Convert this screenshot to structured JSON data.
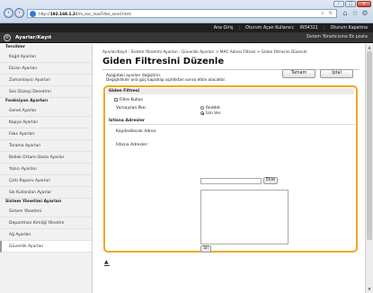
{
  "browser": {
    "url_prefix": "http://",
    "url_host": "192.168.1.2",
    "url_path": "4/m_sec_macFilter_send.html",
    "toolbar_icons": [
      "search-icon",
      "refresh-icon",
      "home-icon",
      "star-icon",
      "gear-icon"
    ],
    "min_label": "–",
    "max_label": "□",
    "close_label": "x"
  },
  "topbar": {
    "home": "Ana Giriş",
    "logout_user": "Oturum Açan Kullanıcı:",
    "username": "IN34321",
    "logout": "Oturum Kapatma"
  },
  "header": {
    "app_title": "Ayarlar/Kayıt",
    "admin_mode": "Sistem Yöneticisine Ek posta"
  },
  "sidebar": {
    "sections": [
      {
        "title": "Tercihler",
        "items": [
          "Kağıt Ayarları",
          "Ekran Ayarları",
          "Zamanlayıcı Ayarları",
          "Ses Düzeyi Denetimi"
        ]
      },
      {
        "title": "Fonksiyon Ayarları",
        "items": [
          "Genel Ayarlar",
          "Kopya Ayarları",
          "Faks Ayarları",
          "Tarama Ayarları",
          "Bellek Ortamı Baskı Ayarlar",
          "Yazıcı Ayarları",
          "Çıktı Raporu Ayarları",
          "Sık Kullanılan Ayarlar"
        ]
      },
      {
        "title": "Sistem Yönetimi Ayarları",
        "items": [
          "Sistem Yönetimi",
          "Departman Kimliği Yönetim",
          "Ağ Ayarları",
          "Güvenlik Ayarları"
        ]
      }
    ],
    "active_item": "Güvenlik Ayarları"
  },
  "main": {
    "breadcrumb": "Ayarlar/Kayıt : Sistem Yönetimi Ayarları : Güvenlik Ayarları > MAC Adresi Filtresi > Giden Filtresini Düzenle",
    "page_title": "Giden Filtresini Düzenle",
    "note1": "Aşağıdaki ayarları değiştirin.",
    "note2": "Değişiklikler ana güç kapatılıp açıldıktan sonra etkin olacaktır.",
    "ok_button": "Tamam",
    "cancel_button": "İptal",
    "back_to_top": "▲"
  },
  "form": {
    "section_title": "Giden Filtresi",
    "use_filter_label": "Filtre Kullan",
    "use_filter_checked": false,
    "default_policy_label": "Varsayılan İlke:",
    "reject_label": "Reddet",
    "allow_label": "İzin Ver",
    "selected_policy": "İzin Ver",
    "exceptions_title": "İstisna Adresler",
    "register_address_label": "Kaydedilecek Adres:",
    "register_address_value": "",
    "add_button": "Ekle",
    "exception_list_label": "İstisna Adresler:",
    "delete_button": "Sil"
  }
}
